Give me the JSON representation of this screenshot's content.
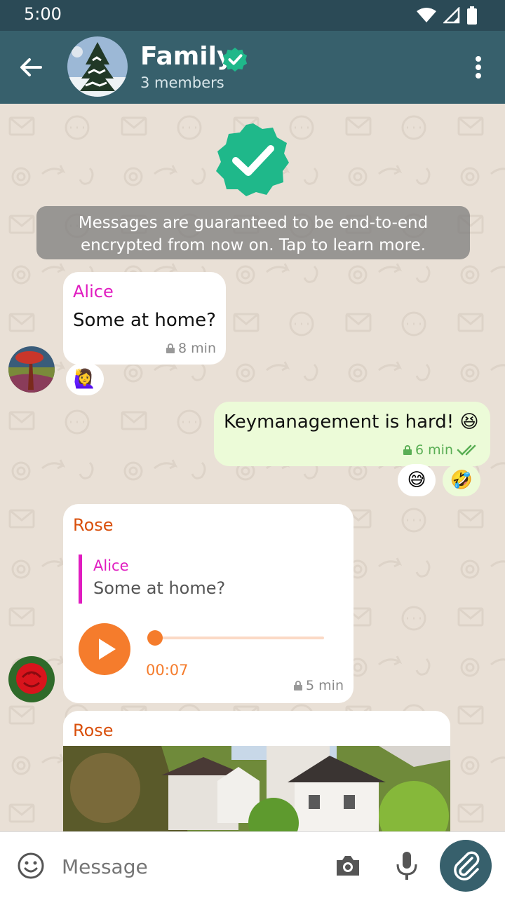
{
  "status": {
    "time": "5:00"
  },
  "header": {
    "title": "Family",
    "subtitle": "3 members"
  },
  "notice": "Messages are guaranteed to be end-to-end encrypted from now on. Tap to learn more.",
  "messages": [
    {
      "sender": "Alice",
      "text": "Some at home?",
      "time": "8 min",
      "reaction": "🙋‍♀️"
    },
    {
      "text": "Keymanagement is hard! 😆",
      "time": "6 min",
      "reactions": [
        "😅",
        "🤣"
      ]
    },
    {
      "sender": "Rose",
      "quote_sender": "Alice",
      "quote_text": "Some at home?",
      "duration": "00:07",
      "time": "5 min"
    },
    {
      "sender": "Rose"
    }
  ],
  "composer": {
    "placeholder": "Message"
  },
  "colors": {
    "appbar": "#37606c",
    "verified": "#1fb88a",
    "alice": "#e01cc0",
    "rose": "#d9500c",
    "audio": "#f57c2c"
  }
}
